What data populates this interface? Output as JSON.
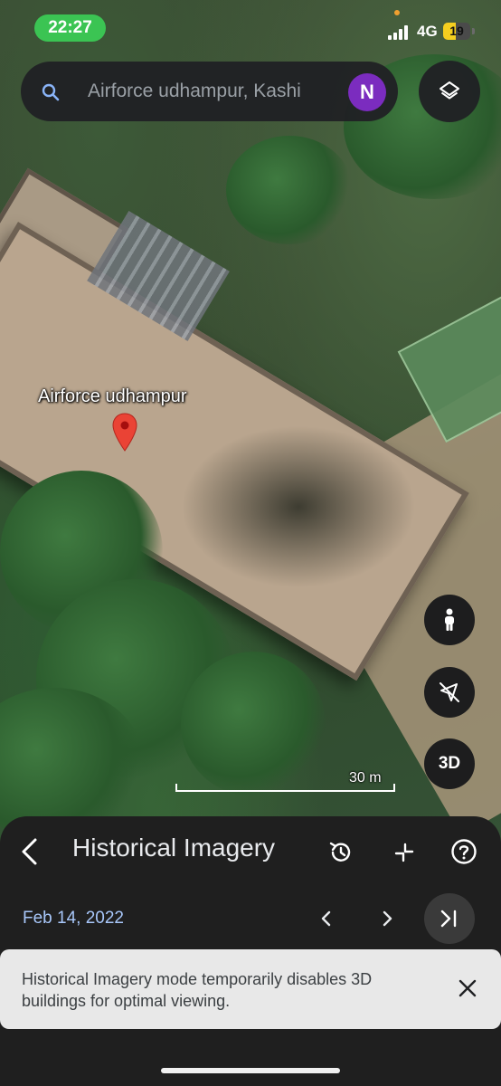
{
  "status_bar": {
    "time": "22:27",
    "network": "4G",
    "battery": "19",
    "battery_fraction": 0.19
  },
  "search": {
    "text": "Airforce udhampur, Kashi",
    "avatar_initial": "N"
  },
  "map": {
    "place_label": "Airforce udhampur",
    "scale_label": "30 m",
    "fab_3d_label": "3D"
  },
  "sheet": {
    "title": "Historical Imagery",
    "date": "Feb 14, 2022"
  },
  "toast": {
    "message": "Historical Imagery mode temporarily disables 3D buildings for optimal viewing."
  },
  "icons": {
    "search": "search-icon",
    "layers": "layers-icon",
    "pin": "map-pin-icon",
    "street_view": "pegman-icon",
    "location": "location-off-icon",
    "back": "back-arrow-icon",
    "history": "history-icon",
    "collapse": "collapse-icon",
    "help": "help-icon",
    "prev": "chevron-left-icon",
    "next": "chevron-right-icon",
    "latest": "skip-to-latest-icon",
    "close": "close-icon"
  },
  "colors": {
    "time_pill": "#3bc453",
    "avatar": "#7b2cbf",
    "pin": "#ea4335",
    "date_text": "#a8c7fa",
    "battery_fill": "#f5cf1f"
  }
}
